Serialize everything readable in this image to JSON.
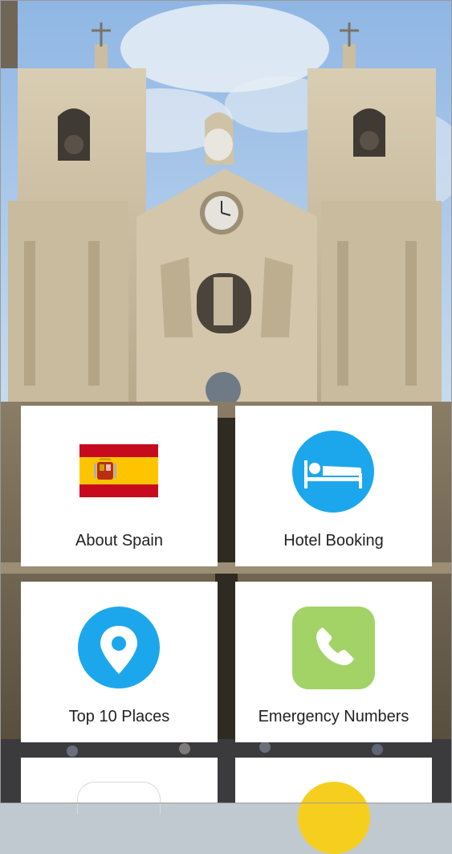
{
  "tiles": [
    {
      "label": "About Spain",
      "icon": "spain-flag-icon"
    },
    {
      "label": "Hotel Booking",
      "icon": "bed-icon"
    },
    {
      "label": "Top 10 Places",
      "icon": "location-pin-icon"
    },
    {
      "label": "Emergency Numbers",
      "icon": "phone-icon"
    },
    {
      "label": "",
      "icon": "partial-icon"
    },
    {
      "label": "",
      "icon": "partial-icon"
    }
  ],
  "colors": {
    "hotel_icon": "#1ca7ec",
    "places_icon": "#1ca7ec",
    "emergency_icon": "#a3d267",
    "flag_red": "#c60b1e",
    "flag_yellow": "#ffc400"
  }
}
